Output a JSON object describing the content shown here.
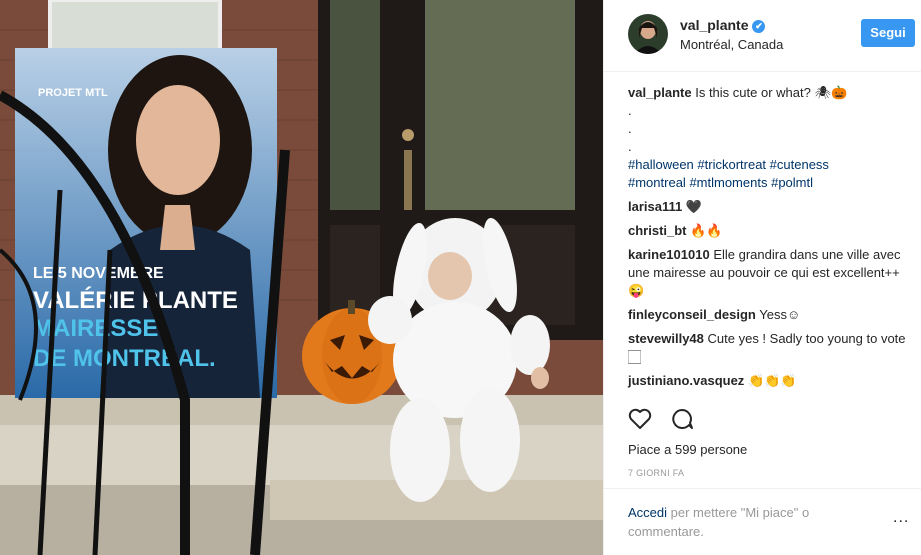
{
  "post": {
    "username": "val_plante",
    "location": "Montréal, Canada",
    "follow_label": "Segui",
    "caption": "Is this cute or what? 🕷🎃",
    "dots": [
      ".",
      ".",
      "."
    ],
    "hashtags": [
      "#halloween",
      "#trickortreat",
      "#cuteness",
      "#montreal",
      "#mtlmoments",
      "#polmtl"
    ]
  },
  "comments": [
    {
      "user": "larisa111",
      "text": "🖤"
    },
    {
      "user": "christi_bt",
      "text": "🔥🔥"
    },
    {
      "user": "karine101010",
      "text": "Elle grandira dans une ville avec une mairesse au pouvoir ce qui est excellent++ 😜"
    },
    {
      "user": "finleyconseil_design",
      "text": "Yess☺"
    },
    {
      "user": "stevewilly48",
      "text": "Cute yes ! Sadly too young to vote 🏻"
    },
    {
      "user": "justiniano.vasquez",
      "text": "👏👏👏"
    }
  ],
  "likes_text": "Piace a 599 persone",
  "date_text": "7 GIORNI FA",
  "footer": {
    "login_link": "Accedi",
    "login_rest": "per mettere \"Mi piace\" o commentare.",
    "more": "..."
  },
  "photo": {
    "poster_brand": "PROJET MTL",
    "poster_line1": "LE 5 NOVEMBRE",
    "poster_line2": "VALÉRIE PLANTE",
    "poster_line3": "MAIRESSE",
    "poster_line4": "DE MONTRÉAL."
  },
  "icons": [
    "heart-icon",
    "comment-icon",
    "verified-icon",
    "more-icon"
  ],
  "colors": {
    "accent": "#3897f0",
    "link": "#003569",
    "muted": "#999999"
  }
}
